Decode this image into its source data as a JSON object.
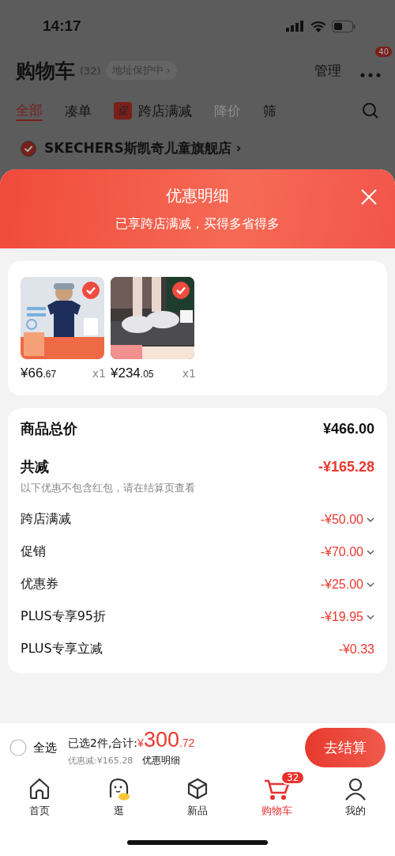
{
  "status_bar": {
    "time": "14:17"
  },
  "header": {
    "title": "购物车",
    "count": "(32)",
    "address_tag": "地址保护中 ›",
    "manage": "管理",
    "more_badge": "40"
  },
  "tabs": [
    {
      "label": "全部",
      "selected": true,
      "disabled": false
    },
    {
      "label": "凑单",
      "selected": false,
      "disabled": false
    },
    {
      "label": "跨店满减",
      "badge": "促",
      "selected": false,
      "disabled": false
    },
    {
      "label": "降价",
      "selected": false,
      "disabled": true
    },
    {
      "label": "筛",
      "selected": false,
      "disabled": false
    }
  ],
  "store": {
    "name": "SKECHERS斯凯奇儿童旗舰店 ›",
    "checked": true
  },
  "sheet": {
    "title": "优惠明细",
    "subtitle": "已享跨店满减，买得多省得多",
    "products": [
      {
        "kind": "picture",
        "checked": true,
        "price_main": "¥66",
        "price_decimal": ".67",
        "qty": "x1"
      },
      {
        "kind": "picture",
        "checked": true,
        "price_main": "¥234",
        "price_decimal": ".05",
        "qty": "x1"
      }
    ],
    "total": {
      "label": "商品总价",
      "value": "¥466.00"
    },
    "reduction": {
      "label": "共减",
      "value": "-¥165.28",
      "note": "以下优惠不包含红包，请在结算页查看"
    },
    "details": [
      {
        "label": "跨店满减",
        "value": "-¥50.00",
        "expandable": true
      },
      {
        "label": "促销",
        "value": "-¥70.00",
        "expandable": true
      },
      {
        "label": "优惠券",
        "value": "-¥25.00",
        "expandable": true
      },
      {
        "label": "PLUS专享95折",
        "value": "-¥19.95",
        "expandable": true
      },
      {
        "label": "PLUS专享立减",
        "value": "-¥0.33",
        "expandable": false
      }
    ]
  },
  "checkout_bar": {
    "select_all": {
      "label": "全选",
      "checked": false
    },
    "summary": "已选2件,合计:",
    "currency": "¥",
    "total_main": "300",
    "total_decimal": ".72",
    "discount": "优惠减:¥165.28",
    "details_link": "优惠明细",
    "button": "去结算"
  },
  "nav": [
    {
      "label": "首页",
      "selected": false
    },
    {
      "label": "逛",
      "selected": false
    },
    {
      "label": "新品",
      "selected": false
    },
    {
      "label": "购物车",
      "badge": "32",
      "selected": true
    },
    {
      "label": "我的",
      "selected": false
    }
  ]
}
